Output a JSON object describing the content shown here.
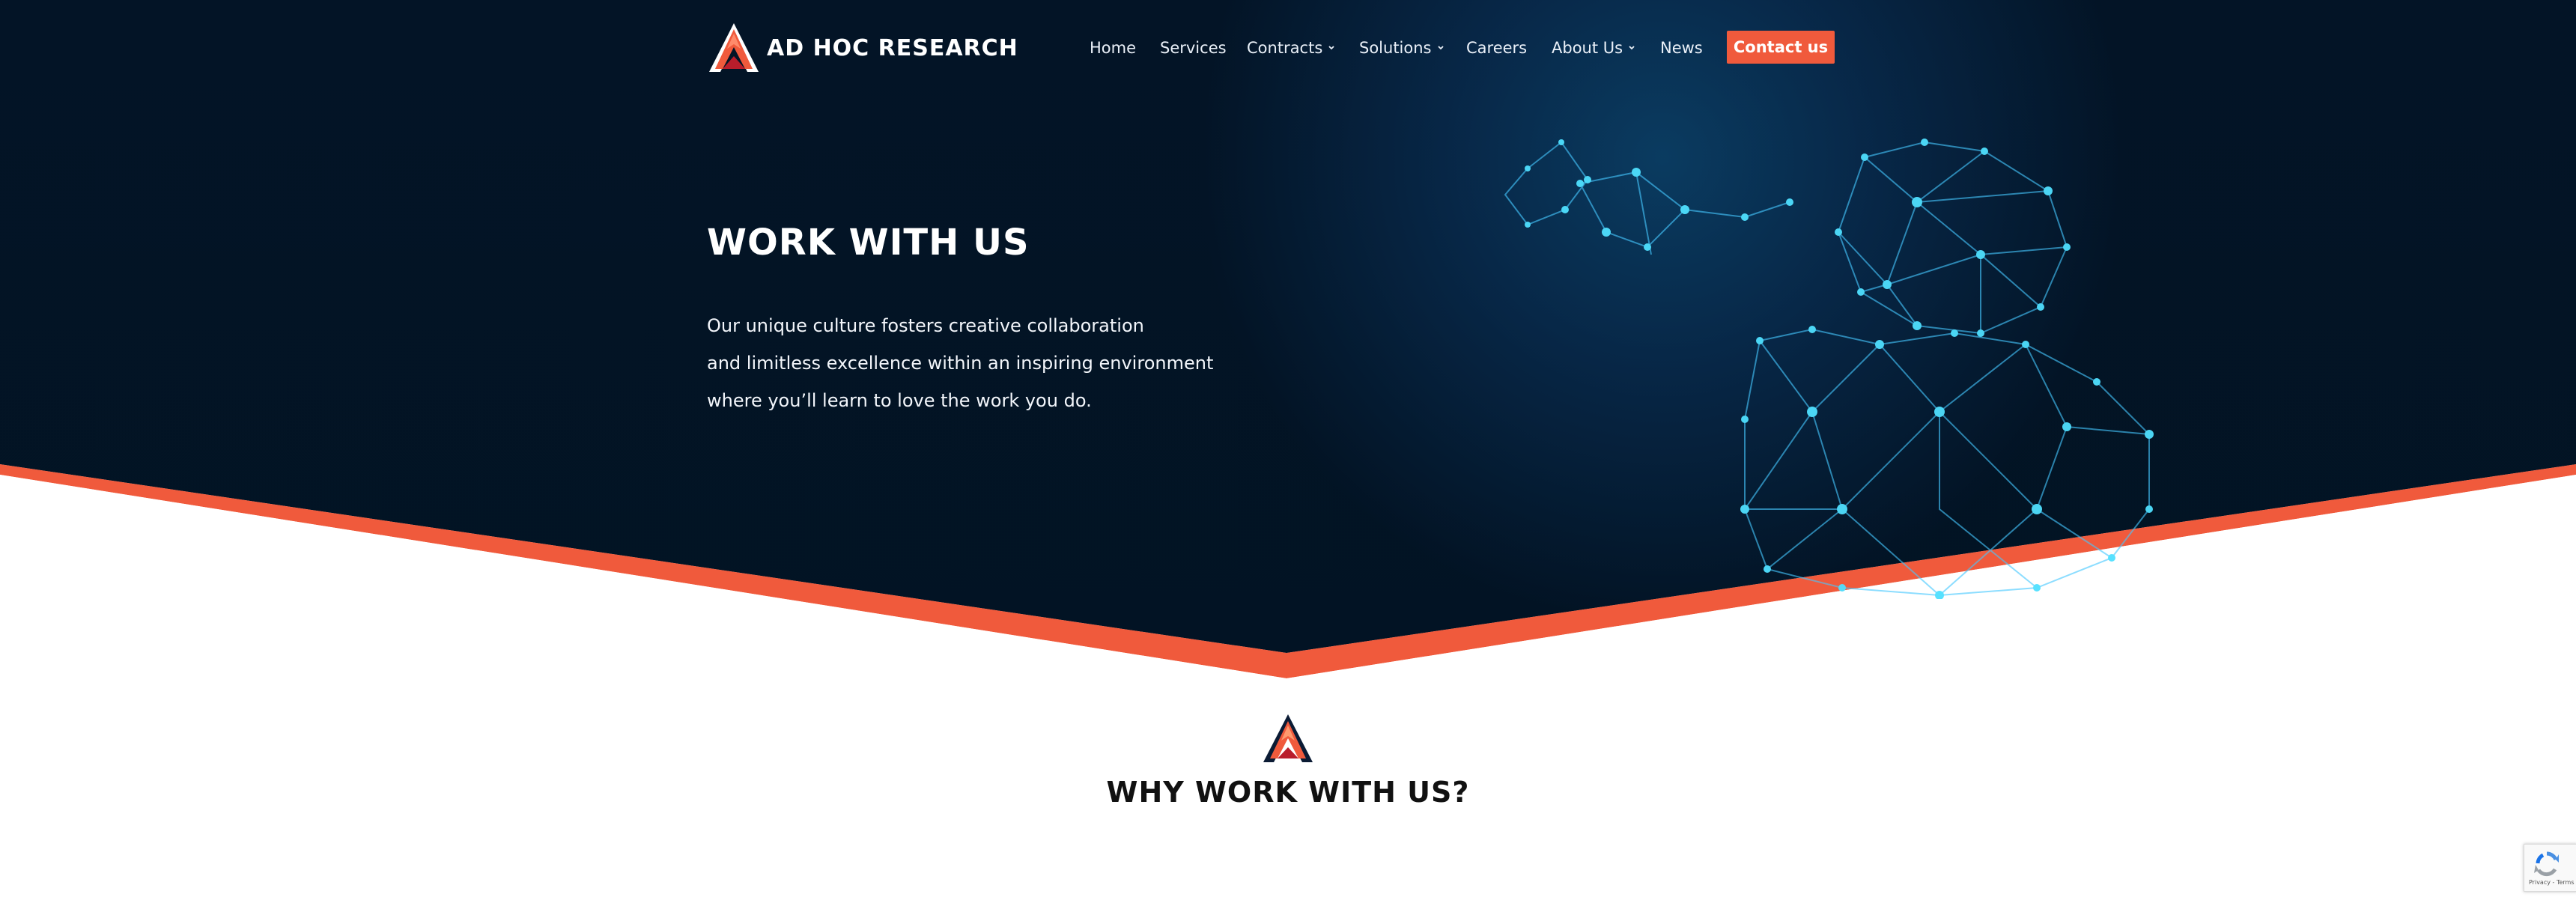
{
  "brand": {
    "name": "AD HOC RESEARCH",
    "accent_color": "#f05a3c",
    "logo_icon": "arrow-a-logo"
  },
  "nav": {
    "items": [
      {
        "label": "Home",
        "has_dropdown": false
      },
      {
        "label": "Services",
        "has_dropdown": false
      },
      {
        "label": "Contracts",
        "has_dropdown": true
      },
      {
        "label": "Solutions",
        "has_dropdown": true
      },
      {
        "label": "Careers",
        "has_dropdown": false
      },
      {
        "label": "About Us",
        "has_dropdown": true
      },
      {
        "label": "News",
        "has_dropdown": false
      }
    ],
    "cta_label": "Contact us"
  },
  "hero": {
    "title": "WORK WITH US",
    "lines": [
      "Our unique culture fosters creative collaboration",
      "and limitless excellence within an inspiring environment",
      "where you’ll learn to love the work you do."
    ],
    "background_color": "#03152b",
    "divider_color": "#f05a3c",
    "illustration": "network-people-icon"
  },
  "section": {
    "title": "WHY WORK WITH US?",
    "icon": "arrow-a-logo"
  },
  "recaptcha": {
    "label": "Privacy - Terms",
    "icon": "recaptcha-icon"
  }
}
